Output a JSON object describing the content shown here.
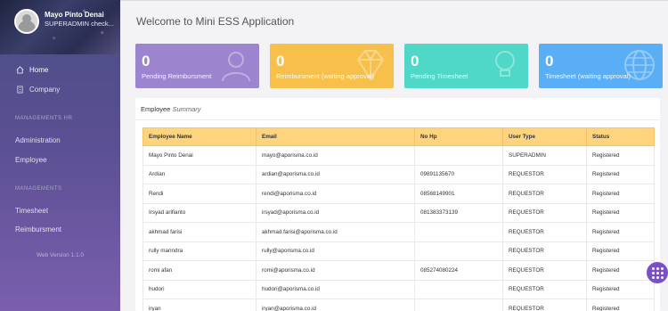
{
  "profile": {
    "name": "Mayo Pinto Denai",
    "role": "SUPERADMIN check..."
  },
  "nav": {
    "home": "Home",
    "company": "Company",
    "section_hr": "MANAGEMENTS HR",
    "administration": "Administration",
    "employee": "Employee",
    "section_mgmt": "MANAGEMENTS",
    "timesheet": "Timesheet",
    "reimbursment": "Reimbursment",
    "version": "Web Version 1.1.0"
  },
  "page": {
    "title": "Welcome to Mini ESS Application"
  },
  "cards": [
    {
      "value": "0",
      "label": "Pending Reimbursment",
      "color": "#9d84cf",
      "icon": "user-icon"
    },
    {
      "value": "0",
      "label": "Reimbursment (waiting approval)",
      "color": "#f7c04b",
      "icon": "diamond-icon"
    },
    {
      "value": "0",
      "label": "Pending Timesheet",
      "color": "#4fd7c7",
      "icon": "bulb-icon"
    },
    {
      "value": "0",
      "label": "Timesheet (waiting approval)",
      "color": "#5aaef5",
      "icon": "globe-icon"
    }
  ],
  "summary": {
    "title": "Employee",
    "subtitle": "Summary",
    "columns": [
      "Employee Name",
      "Email",
      "No Hp",
      "User Type",
      "Status"
    ],
    "rows": [
      [
        "Mayo Pinto Denai",
        "mayo@aporisma.co.id",
        "",
        "SUPERADMIN",
        "Registered"
      ],
      [
        "Ardian",
        "ardian@aporisma.co.id",
        "09891135670",
        "REQUESTOR",
        "Registered"
      ],
      [
        "Rendi",
        "rendi@aporisma.co.id",
        "08568149901",
        "REQUESTOR",
        "Registered"
      ],
      [
        "Irsyad arifianto",
        "irsyad@aporisma.co.id",
        "081383373139",
        "REQUESTOR",
        "Registered"
      ],
      [
        "akhmad farisi",
        "akhmad.farisi@aporisma.co.id",
        "",
        "REQUESTOR",
        "Registered"
      ],
      [
        "rully marindra",
        "rully@aporisma.co.id",
        "",
        "REQUESTOR",
        "Registered"
      ],
      [
        "romi afan",
        "romi@aporisma.co.id",
        "085274080224",
        "REQUESTOR",
        "Registered"
      ],
      [
        "hudori",
        "hudori@aporisma.co.id",
        "",
        "REQUESTOR",
        "Registered"
      ],
      [
        "iryan",
        "iryan@aporisma.co.id",
        "",
        "REQUESTOR",
        "Registered"
      ]
    ]
  },
  "colors": {
    "accent": "#7b4fc8",
    "table_header": "#ffd47e"
  }
}
